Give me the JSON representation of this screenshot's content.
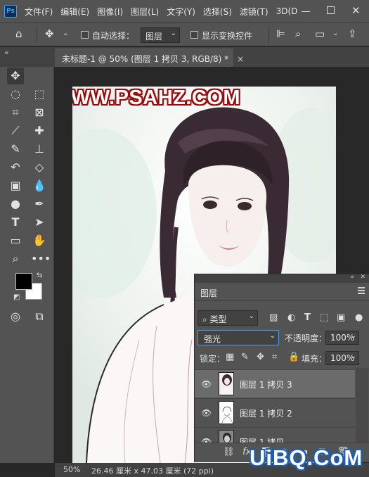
{
  "app": {
    "logo_text": "Ps"
  },
  "menu": {
    "items": [
      "文件(F)",
      "编辑(E)",
      "图像(I)",
      "图层(L)",
      "文字(Y)",
      "选择(S)",
      "滤镜(T)",
      "3D(D"
    ]
  },
  "options": {
    "auto_select_label": "自动选择：",
    "layer_select_value": "图层",
    "show_transform_label": "显示变换控件"
  },
  "document_tab": {
    "title": "未标题-1 @ 50% (图层 1 拷贝 3, RGB/8) *"
  },
  "canvas": {
    "watermark": "WWW.PSAHZ.COM"
  },
  "status": {
    "zoom": "50%",
    "doc_size": "26.46 厘米 x 47.03 厘米 (72 ppi)"
  },
  "layers_panel": {
    "title": "图层",
    "filter_value": "类型",
    "blend_mode": "强光",
    "opacity_label": "不透明度：",
    "opacity_value": "100%",
    "lock_label": "锁定：",
    "fill_label": "填充：",
    "fill_value": "100%",
    "layers": [
      {
        "name": "图层 1 拷贝 3",
        "selected": true
      },
      {
        "name": "图层 1 拷贝 2",
        "selected": false
      },
      {
        "name": "图层 1 拷贝",
        "selected": false
      }
    ]
  },
  "corner_logo": "UiBQ.CoM",
  "icons": {
    "toolbar": [
      "move-icon",
      "lasso-icon",
      "quick-select-icon",
      "crop-icon",
      "frame-icon",
      "eyedropper-icon",
      "healing-icon",
      "brush-icon",
      "stamp-icon",
      "history-brush-icon",
      "eraser-icon",
      "gradient-icon",
      "blur-icon",
      "dodge-icon",
      "pen-icon",
      "type-icon",
      "path-select-icon",
      "rectangle-icon",
      "hand-icon",
      "zoom-icon",
      "more-icon"
    ]
  }
}
